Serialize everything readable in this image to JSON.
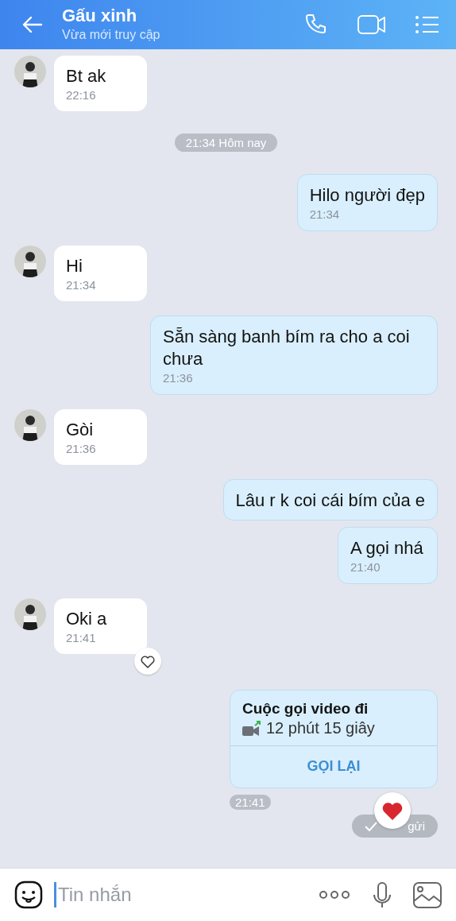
{
  "header": {
    "name": "Gấu xinh",
    "status": "Vừa mới truy cập"
  },
  "messages": [
    {
      "kind": "text",
      "outgoing": false,
      "text": "Bt ak",
      "time": "22:16",
      "react_button": false
    },
    {
      "kind": "date",
      "text": "21:34 Hôm nay"
    },
    {
      "kind": "text",
      "outgoing": true,
      "text": "Hilo người đẹp",
      "time": "21:34"
    },
    {
      "kind": "text",
      "outgoing": false,
      "text": "Hi",
      "time": "21:34",
      "react_button": false
    },
    {
      "kind": "text",
      "outgoing": true,
      "text": "Sẵn sàng banh bím ra cho a coi chưa",
      "time": "21:36"
    },
    {
      "kind": "text",
      "outgoing": false,
      "text": "Gòi",
      "time": "21:36",
      "react_button": false
    },
    {
      "kind": "text",
      "outgoing": true,
      "text": "Lâu r k coi cái bím của e"
    },
    {
      "kind": "text",
      "outgoing": true,
      "text": "A gọi nhá",
      "time": "21:40"
    },
    {
      "kind": "text",
      "outgoing": false,
      "text": "Oki a",
      "time": "21:41",
      "react_button": true
    },
    {
      "kind": "call",
      "title": "Cuộc gọi video đi",
      "duration": "12 phút 15 giây",
      "action": "GỌI LẠI",
      "time": "21:41",
      "status": "gửi",
      "reacted": true
    }
  ],
  "composer": {
    "placeholder": "Tin nhắn"
  }
}
